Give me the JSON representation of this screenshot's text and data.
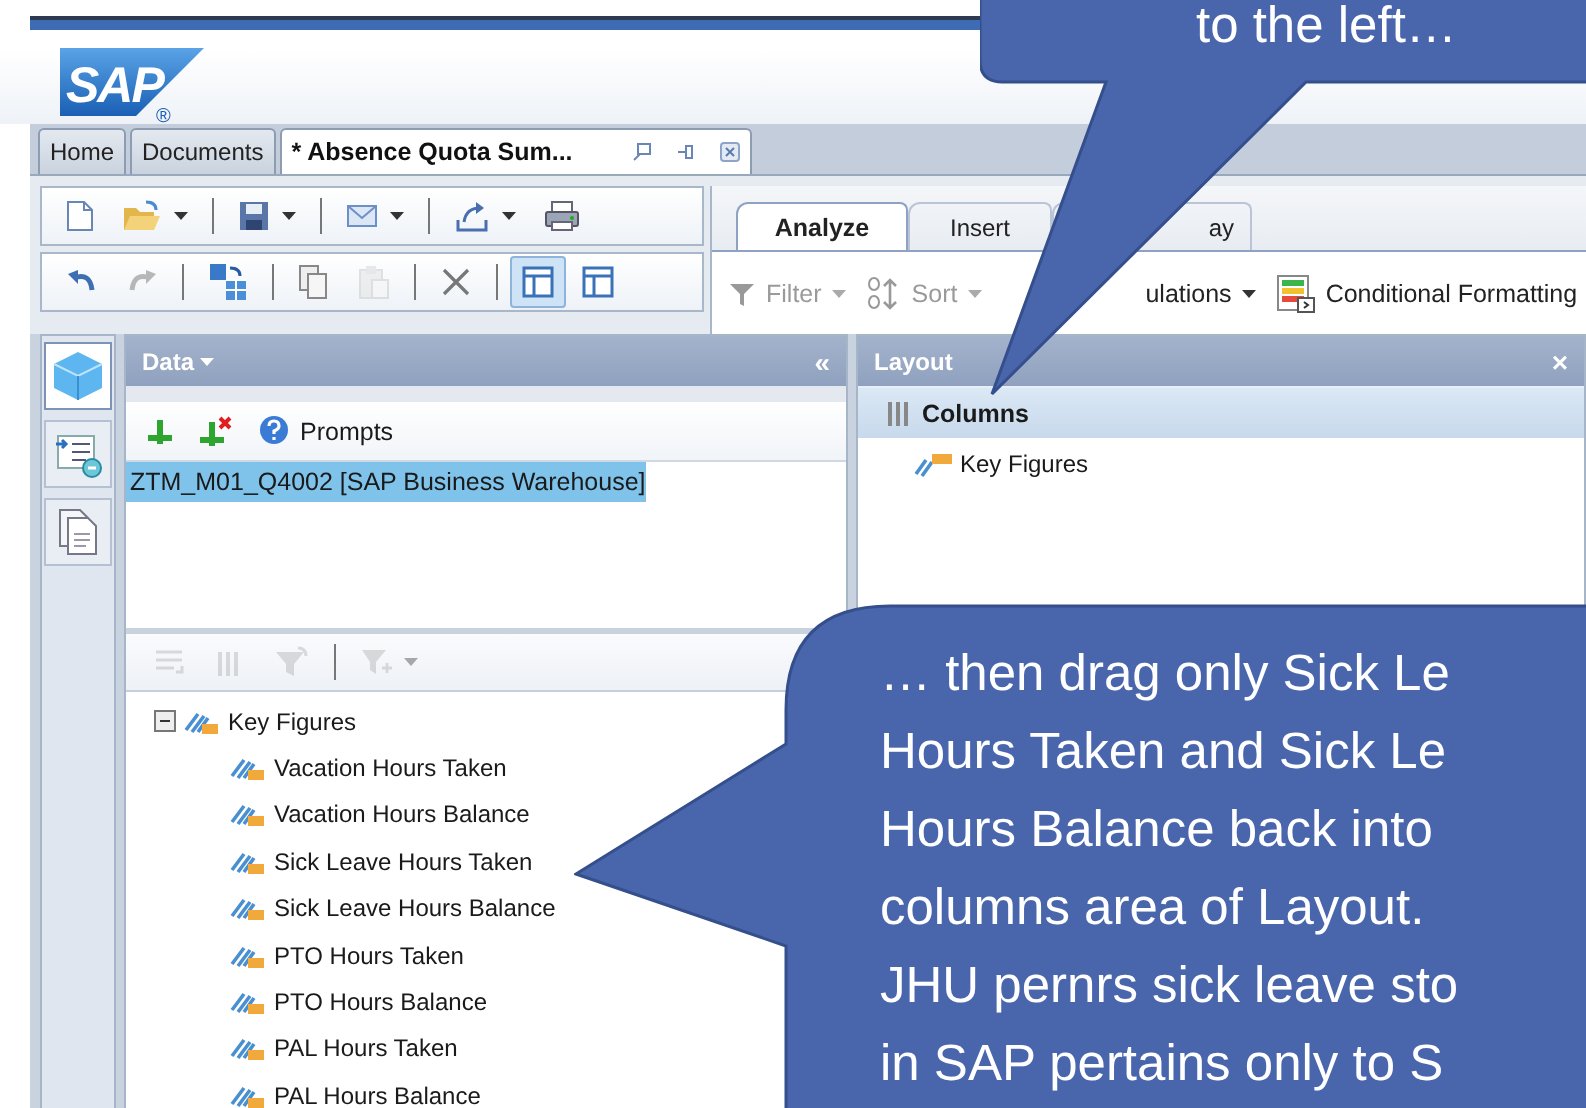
{
  "logo": {
    "text": "SAP",
    "mark": "®"
  },
  "doc_tabs": [
    {
      "label": "Home",
      "selected": false
    },
    {
      "label": "Documents",
      "selected": false
    },
    {
      "label": "* Absence Quota Sum...",
      "selected": true
    }
  ],
  "toolbars": [
    {
      "items": [
        {
          "kind": "button",
          "dropdown": false,
          "disabled": false,
          "selected": false
        },
        {
          "kind": "button",
          "dropdown": true,
          "disabled": false,
          "selected": false
        },
        {
          "kind": "separator"
        },
        {
          "kind": "button",
          "dropdown": true,
          "disabled": false,
          "selected": false
        },
        {
          "kind": "separator"
        },
        {
          "kind": "button",
          "dropdown": true,
          "disabled": false,
          "selected": false
        },
        {
          "kind": "separator"
        },
        {
          "kind": "button",
          "dropdown": true,
          "disabled": false,
          "selected": false
        },
        {
          "kind": "button",
          "dropdown": false,
          "disabled": false,
          "selected": false
        }
      ]
    },
    {
      "items": [
        {
          "kind": "button",
          "dropdown": false,
          "disabled": false,
          "selected": false
        },
        {
          "kind": "button",
          "dropdown": false,
          "disabled": true,
          "selected": false
        },
        {
          "kind": "separator"
        },
        {
          "kind": "button",
          "dropdown": false,
          "disabled": false,
          "selected": false
        },
        {
          "kind": "separator"
        },
        {
          "kind": "button",
          "dropdown": false,
          "disabled": false,
          "selected": false
        },
        {
          "kind": "button",
          "dropdown": false,
          "disabled": true,
          "selected": false
        },
        {
          "kind": "separator"
        },
        {
          "kind": "button",
          "dropdown": false,
          "disabled": false,
          "selected": false
        },
        {
          "kind": "separator"
        },
        {
          "kind": "button",
          "dropdown": false,
          "disabled": false,
          "selected": true
        },
        {
          "kind": "button",
          "dropdown": false,
          "disabled": false,
          "selected": false
        }
      ]
    }
  ],
  "ribbon_tabs": [
    {
      "label": "Analyze",
      "selected": true
    },
    {
      "label": "Insert",
      "selected": false
    },
    {
      "label": "ay",
      "selected": false
    }
  ],
  "ribbon_buttons": [
    {
      "label": "Filter",
      "dropdown": true,
      "disabled": true
    },
    {
      "label": "Sort",
      "dropdown": true,
      "disabled": true
    },
    {
      "label": "ulations",
      "dropdown": true,
      "disabled": false
    },
    {
      "label": "Conditional Formatting",
      "dropdown": false,
      "disabled": false
    }
  ],
  "side_rail": [
    {
      "selected": true
    },
    {
      "selected": false
    },
    {
      "selected": false
    }
  ],
  "data_panel": {
    "title": "Data",
    "collapse": "«",
    "prompts": "Prompts",
    "sources": [
      {
        "label": "ZTM_M01_Q4002 [SAP Business Warehouse]",
        "selected": true
      }
    ],
    "tree_toolbar": [
      {
        "kind": "button",
        "dropdown": false,
        "disabled": true
      },
      {
        "kind": "button",
        "dropdown": false,
        "disabled": true
      },
      {
        "kind": "button",
        "dropdown": false,
        "disabled": true
      },
      {
        "kind": "separator"
      },
      {
        "kind": "button",
        "dropdown": true,
        "disabled": true
      }
    ],
    "tree": [
      {
        "label": "Key Figures",
        "expanded": true,
        "children": [
          {
            "label": "Vacation Hours Taken"
          },
          {
            "label": "Vacation Hours Balance"
          },
          {
            "label": "Sick Leave Hours Taken"
          },
          {
            "label": "Sick Leave Hours Balance"
          },
          {
            "label": "PTO Hours Taken"
          },
          {
            "label": "PTO Hours Balance"
          },
          {
            "label": "PAL Hours Taken"
          },
          {
            "label": "PAL Hours Balance"
          }
        ]
      }
    ]
  },
  "layout_panel": {
    "title": "Layout",
    "close": "×",
    "sections": [
      {
        "label": "Columns",
        "items": [
          {
            "label": "Key Figures"
          }
        ]
      }
    ]
  },
  "callouts": [
    {
      "lines": [
        "to the left…"
      ]
    },
    {
      "lines": [
        "… then drag only Sick Le",
        "Hours Taken and Sick Le",
        "Hours Balance back into",
        "columns area of Layout.",
        "JHU pernrs sick leave sto",
        "in SAP pertains only to S"
      ]
    }
  ]
}
